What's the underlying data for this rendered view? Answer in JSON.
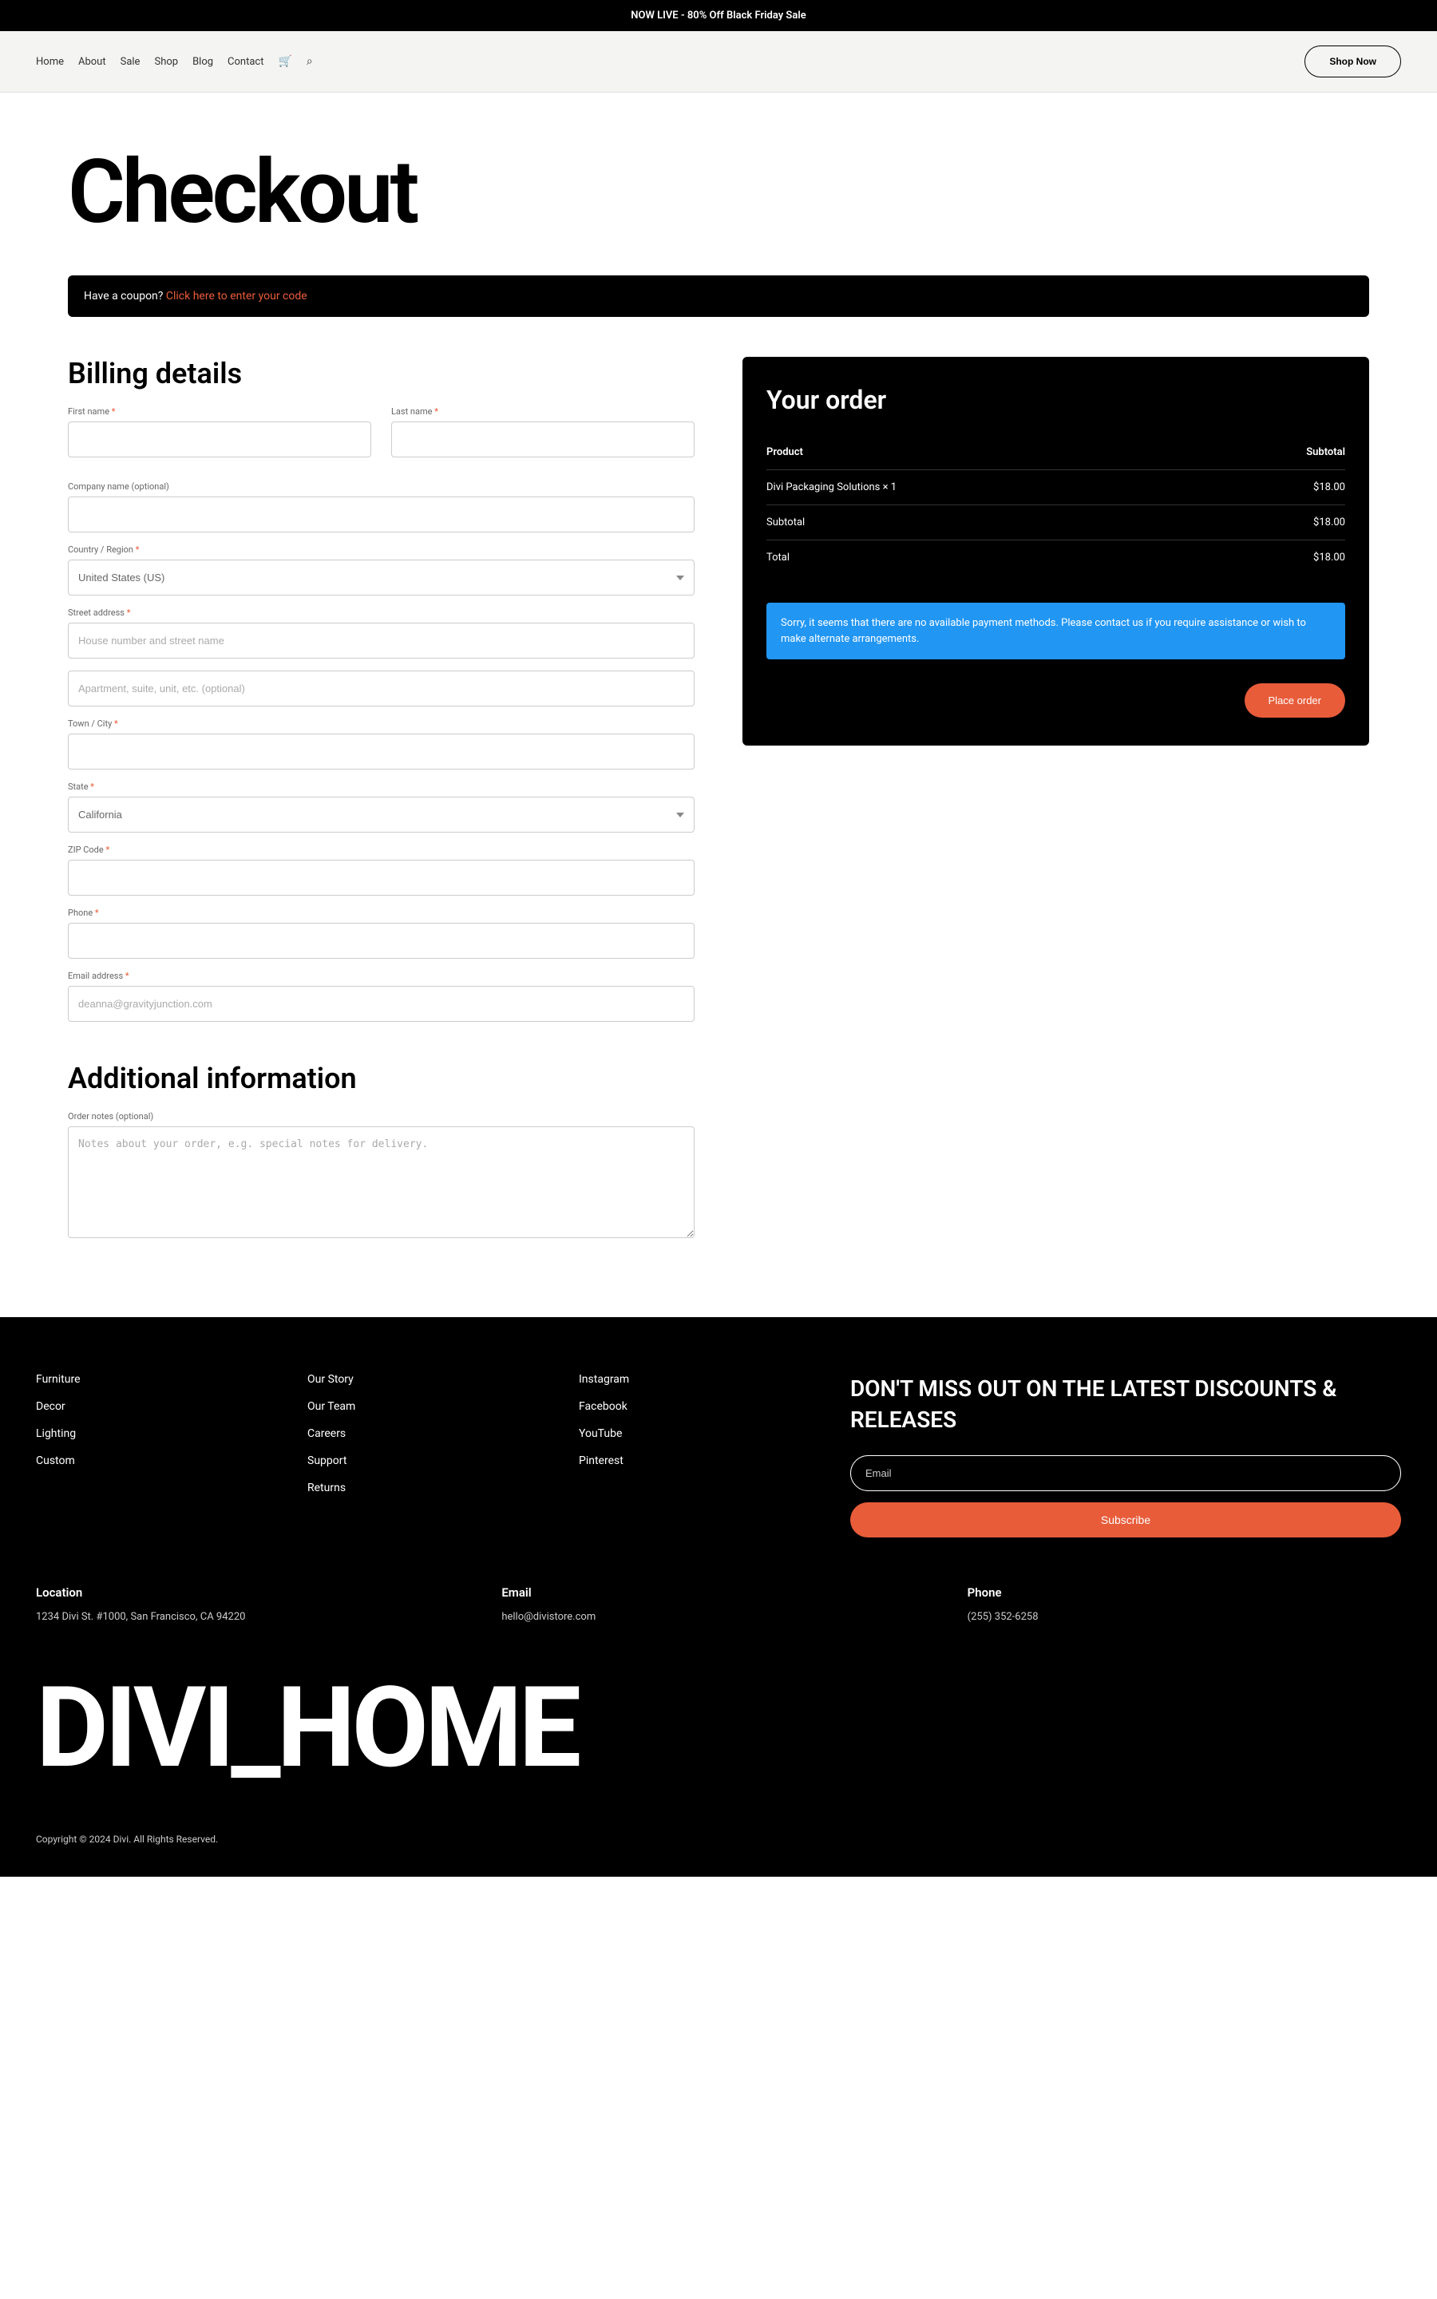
{
  "banner": "NOW LIVE - 80% Off Black Friday Sale",
  "nav": {
    "items": [
      "Home",
      "About",
      "Sale",
      "Shop",
      "Blog",
      "Contact"
    ],
    "shopNow": "Shop Now"
  },
  "pageTitle": "Checkout",
  "coupon": {
    "prompt": "Have a coupon? ",
    "link": "Click here to enter your code"
  },
  "billing": {
    "title": "Billing details",
    "firstName": "First name",
    "lastName": "Last name",
    "company": "Company name (optional)",
    "country": "Country / Region",
    "countryValue": "United States (US)",
    "street": "Street address",
    "streetPlaceholder": "House number and street name",
    "street2Placeholder": "Apartment, suite, unit, etc. (optional)",
    "city": "Town / City",
    "state": "State",
    "stateValue": "California",
    "zip": "ZIP Code",
    "phone": "Phone",
    "email": "Email address",
    "emailPlaceholder": "deanna@gravityjunction.com"
  },
  "additional": {
    "title": "Additional information",
    "notesLabel": "Order notes (optional)",
    "notesPlaceholder": "Notes about your order, e.g. special notes for delivery."
  },
  "order": {
    "title": "Your order",
    "headers": {
      "product": "Product",
      "subtotal": "Subtotal"
    },
    "item": {
      "name": "Divi Packaging Solutions  × 1",
      "price": "$18.00"
    },
    "subtotalLabel": "Subtotal",
    "subtotalValue": "$18.00",
    "totalLabel": "Total",
    "totalValue": "$18.00",
    "notice": "Sorry, it seems that there are no available payment methods. Please contact us if you require assistance or wish to make alternate arrangements.",
    "placeOrder": "Place order"
  },
  "footer": {
    "col1": [
      "Furniture",
      "Decor",
      "Lighting",
      "Custom"
    ],
    "col2": [
      "Our Story",
      "Our Team",
      "Careers",
      "Support",
      "Returns"
    ],
    "col3": [
      "Instagram",
      "Facebook",
      "YouTube",
      "Pinterest"
    ],
    "newsletterTitle": "DON'T MISS OUT ON THE LATEST DISCOUNTS & RELEASES",
    "emailPlaceholder": "Email",
    "subscribe": "Subscribe",
    "location": {
      "label": "Location",
      "value": "1234 Divi St. #1000, San Francisco, CA 94220"
    },
    "email": {
      "label": "Email",
      "value": "hello@divistore.com"
    },
    "phone": {
      "label": "Phone",
      "value": "(255) 352-6258"
    },
    "logo": "DIVI_HOME",
    "copyright": "Copyright © 2024 Divi. All Rights Reserved."
  }
}
